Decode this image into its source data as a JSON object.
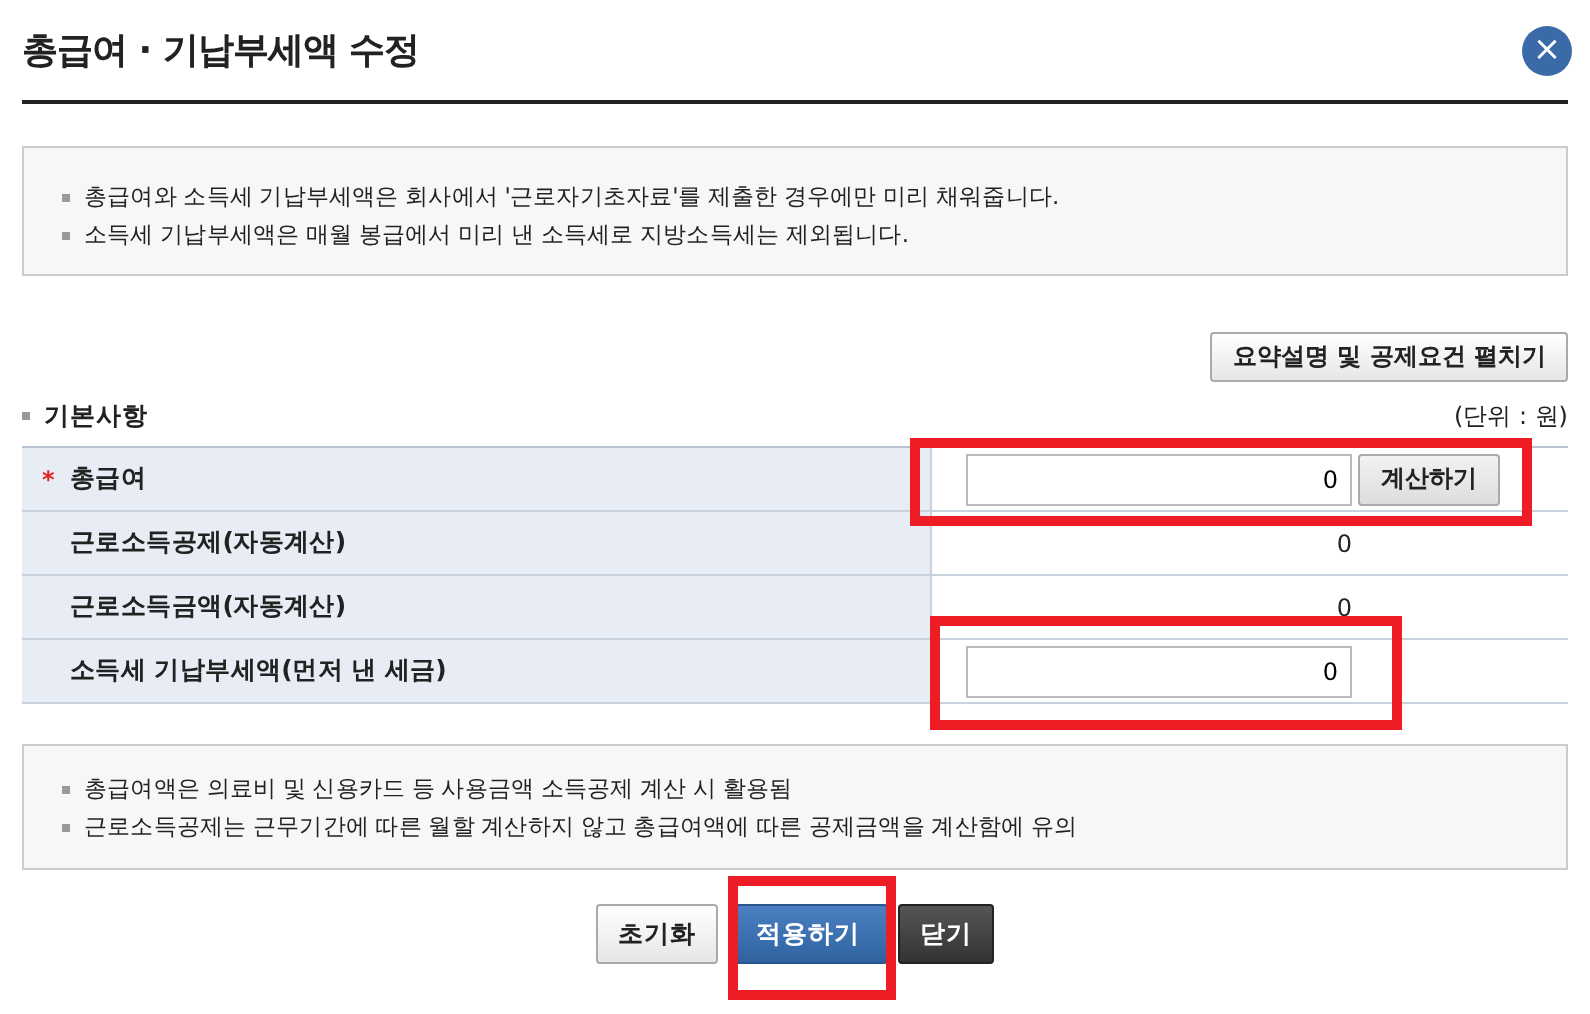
{
  "window": {
    "title": "총급여 · 기납부세액 수정",
    "close": "×"
  },
  "info_notes": [
    "총급여와 소득세 기납부세액은 회사에서 '근로자기초자료'를 제출한 경우에만 미리 채워줍니다.",
    "소득세 기납부세액은 매월 봉급에서 미리 낸 소득세로 지방소득세는 제외됩니다."
  ],
  "expand_button": "요약설명 및 공제요건 펼치기",
  "section": {
    "title": "기본사항",
    "unit": "(단위 : 원)"
  },
  "rows": [
    {
      "kind": "input_button",
      "label": "총급여",
      "required_mark": "*",
      "value": "0",
      "button": "계산하기"
    },
    {
      "kind": "readonly",
      "label": "근로소득공제(자동계산)",
      "value": "0"
    },
    {
      "kind": "readonly",
      "label": "근로소득금액(자동계산)",
      "value": "0"
    },
    {
      "kind": "input",
      "label": "소득세 기납부세액(먼저 낸 세금)",
      "value": "0"
    }
  ],
  "bottom_notes": [
    "총급여액은 의료비 및 신용카드 등 사용금액 소득공제 계산 시 활용됨",
    "근로소득공제는 근무기간에 따른 월할 계산하지 않고 총급여액에 따른 공제금액을 계산함에 유의"
  ],
  "buttons": [
    {
      "label": "초기화",
      "kind": "plain"
    },
    {
      "label": "적용하기",
      "kind": "primary"
    },
    {
      "label": "닫기",
      "kind": "dark"
    }
  ],
  "annotations": [
    {
      "kind": "highlight"
    },
    {
      "kind": "highlight"
    },
    {
      "kind": "highlight"
    }
  ]
}
